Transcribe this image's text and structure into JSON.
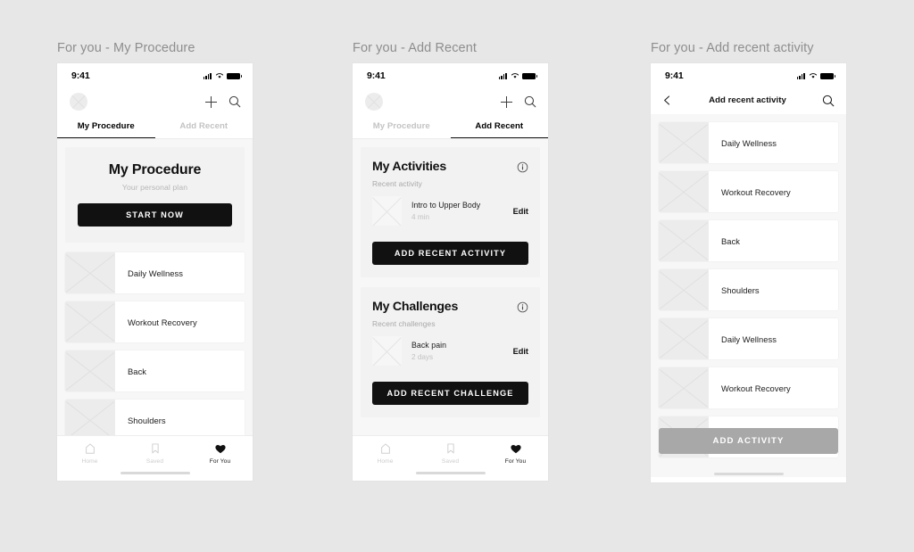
{
  "background_color": "#e7e7e7",
  "accent_dark": "#111111",
  "accent_disabled": "#a8a8a8",
  "status_bar": {
    "time": "9:41",
    "signal_icon": "cellular-signal-icon",
    "wifi_icon": "wifi-icon",
    "battery_icon": "battery-icon"
  },
  "screens": [
    {
      "caption": "For you - My Procedure",
      "appbar": {
        "avatar_name": "avatar",
        "add_label": "+",
        "add_icon": "plus-icon",
        "search_icon": "search-icon"
      },
      "tabs": [
        {
          "label": "My Procedure",
          "active": true
        },
        {
          "label": "Add Recent",
          "active": false
        }
      ],
      "hero": {
        "title": "My Procedure",
        "subtitle": "Your personal plan",
        "cta_label": "START NOW"
      },
      "items": [
        {
          "label": "Daily Wellness"
        },
        {
          "label": "Workout Recovery"
        },
        {
          "label": "Back"
        },
        {
          "label": "Shoulders"
        }
      ],
      "tabbar": [
        {
          "label": "Home",
          "icon": "home-icon",
          "active": false
        },
        {
          "label": "Saved",
          "icon": "bookmark-icon",
          "active": false
        },
        {
          "label": "For You",
          "icon": "heart-icon",
          "active": true
        }
      ]
    },
    {
      "caption": "For you - Add Recent",
      "appbar": {
        "avatar_name": "avatar",
        "add_label": "+",
        "add_icon": "plus-icon",
        "search_icon": "search-icon"
      },
      "tabs": [
        {
          "label": "My Procedure",
          "active": false
        },
        {
          "label": "Add Recent",
          "active": true
        }
      ],
      "sections": [
        {
          "title": "My Activities",
          "info_icon": "info-icon",
          "subtitle": "Recent activity",
          "entry": {
            "title": "Intro to Upper Body",
            "meta": "4 min",
            "edit_label": "Edit"
          },
          "cta_label": "ADD RECENT ACTIVITY"
        },
        {
          "title": "My Challenges",
          "info_icon": "info-icon",
          "subtitle": "Recent challenges",
          "entry": {
            "title": "Back pain",
            "meta": "2 days",
            "edit_label": "Edit"
          },
          "cta_label": "ADD RECENT CHALLENGE"
        }
      ],
      "tabbar": [
        {
          "label": "Home",
          "icon": "home-icon",
          "active": false
        },
        {
          "label": "Saved",
          "icon": "bookmark-icon",
          "active": false
        },
        {
          "label": "For You",
          "icon": "heart-icon",
          "active": true
        }
      ]
    },
    {
      "caption": "For you - Add recent activity",
      "navbar": {
        "back_icon": "chevron-left-icon",
        "title": "Add recent activity",
        "search_icon": "search-icon"
      },
      "items": [
        {
          "label": "Daily Wellness"
        },
        {
          "label": "Workout Recovery"
        },
        {
          "label": "Back"
        },
        {
          "label": "Shoulders"
        },
        {
          "label": "Daily Wellness"
        },
        {
          "label": "Workout Recovery"
        }
      ],
      "cta_label": "ADD ACTIVITY",
      "cta_enabled": false
    }
  ]
}
